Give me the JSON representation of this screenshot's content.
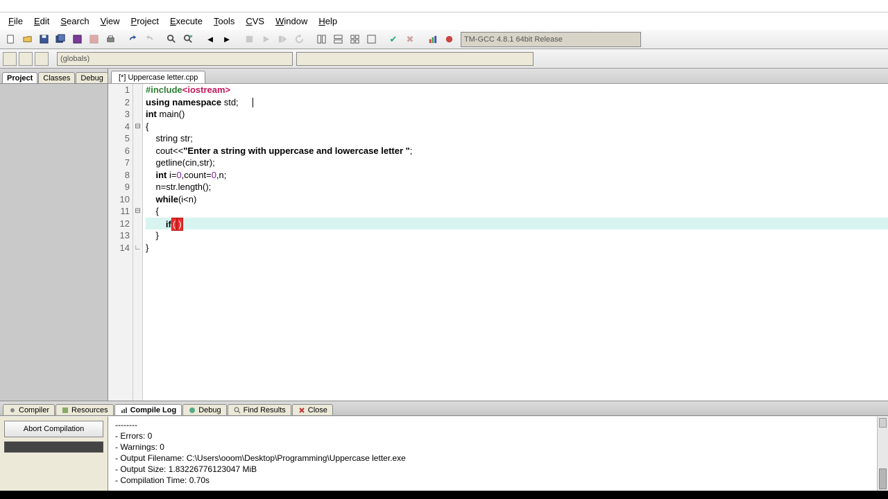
{
  "menu": {
    "items": [
      "File",
      "Edit",
      "Search",
      "View",
      "Project",
      "Execute",
      "Tools",
      "CVS",
      "Window",
      "Help"
    ]
  },
  "compiler_select": "TM-GCC 4.8.1 64bit Release",
  "globals_dd": "(globals)",
  "side_tabs": {
    "project": "Project",
    "classes": "Classes",
    "debug": "Debug"
  },
  "file_tab": "[*] Uppercase letter.cpp",
  "code": {
    "l1_pre": "#include",
    "l1_ang": "<iostream>",
    "l2_a": "using namespace ",
    "l2_b": "std;",
    "l3_a": "int",
    "l3_b": " main()",
    "l4": "{",
    "l5": "    string str;",
    "l6_a": "    cout<<",
    "l6_b": "\"Enter a string with uppercase and lowercase letter \"",
    "l6_c": ";",
    "l7": "    getline(cin,str);",
    "l8_a": "    ",
    "l8_b": "int",
    "l8_c": " i=",
    "l8_d": "0",
    "l8_e": ",count=",
    "l8_f": "0",
    "l8_g": ",n;",
    "l9": "    n=str.length();",
    "l10_a": "    ",
    "l10_b": "while",
    "l10_c": "(i<n)",
    "l11": "    {",
    "l12_a": "        ",
    "l12_b": "if",
    "l12_c": "(",
    "l12_d": ")",
    "l13": "    }",
    "l14": "}"
  },
  "line_numbers": [
    "1",
    "2",
    "3",
    "4",
    "5",
    "6",
    "7",
    "8",
    "9",
    "10",
    "11",
    "12",
    "13",
    "14"
  ],
  "fold": {
    "l4": "⊟",
    "l11": "⊟",
    "l14": "∟"
  },
  "bottom_tabs": {
    "compiler": "Compiler",
    "resources": "Resources",
    "compile_log": "Compile Log",
    "debug": "Debug",
    "find": "Find Results",
    "close": "Close"
  },
  "abort_btn": "Abort Compilation",
  "log": {
    "l1": "--------",
    "l2": "- Errors: 0",
    "l3": "- Warnings: 0",
    "l4": "- Output Filename: C:\\Users\\ooom\\Desktop\\Programming\\Uppercase letter.exe",
    "l5": "- Output Size: 1.83226776123047 MiB",
    "l6": "- Compilation Time: 0.70s"
  }
}
